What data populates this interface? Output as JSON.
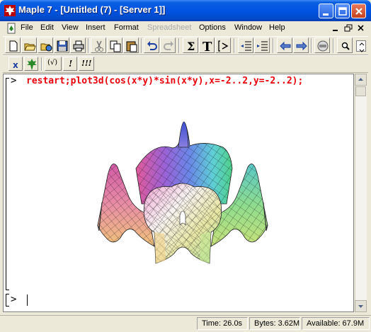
{
  "window": {
    "title": "Maple 7  - [Untitled (7) - [Server 1]]",
    "app_icon": "maple-leaf-icon"
  },
  "menu": {
    "items": [
      {
        "label": "File"
      },
      {
        "label": "Edit"
      },
      {
        "label": "View"
      },
      {
        "label": "Insert"
      },
      {
        "label": "Format"
      },
      {
        "label": "Spreadsheet",
        "disabled": true
      },
      {
        "label": "Options"
      },
      {
        "label": "Window"
      },
      {
        "label": "Help"
      }
    ]
  },
  "toolbar": {
    "buttons": [
      "new-document-icon",
      "open-icon",
      "open-url-icon",
      "save-icon",
      "print-icon",
      "cut-icon",
      "copy-icon",
      "paste-icon",
      "undo-icon",
      "redo-icon",
      "sigma-icon",
      "text-icon",
      "prompt-icon",
      "outdent-icon",
      "indent-icon",
      "back-arrow-icon",
      "forward-arrow-icon",
      "stop-icon",
      "zoom-icon"
    ],
    "sigma_glyph": "Σ",
    "text_glyph": "T",
    "prompt_glyph": "[>",
    "zoom_glyph": "🔍"
  },
  "context_bar": {
    "x_label": "x",
    "check_label": "(√)",
    "bang_label": "!",
    "triple_bang_label": "!!!"
  },
  "worksheet": {
    "prompt": ">",
    "input": "restart;plot3d(cos(x*y)*sin(x*y),x=-2..2,y=-2..2);",
    "plot": {
      "type": "3d-surface",
      "function": "cos(x*y)*sin(x*y)",
      "x_range": [
        -2,
        2
      ],
      "y_range": [
        -2,
        2
      ]
    },
    "next_prompt": ">"
  },
  "status": {
    "time": "Time:  26.0s",
    "bytes": "Bytes: 3.62M",
    "available": "Available: 67.9M"
  },
  "colors": {
    "input_text": "#e8000b",
    "titlebar": "#0054e3"
  }
}
